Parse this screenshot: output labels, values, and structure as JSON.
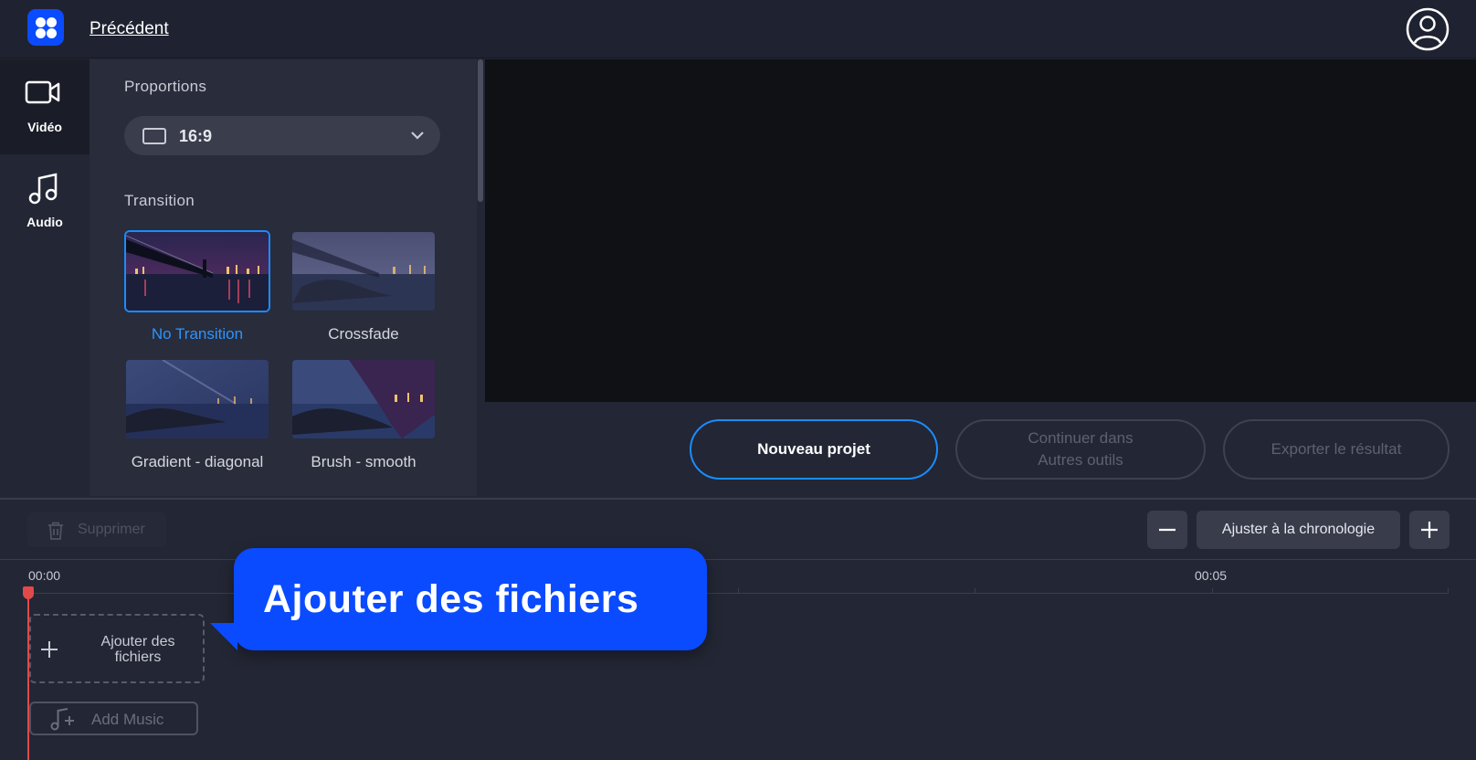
{
  "header": {
    "back_label": "Précédent"
  },
  "nav": {
    "items": [
      {
        "label": "Vidéo",
        "icon": "video-camera-icon"
      },
      {
        "label": "Audio",
        "icon": "music-note-icon"
      }
    ]
  },
  "panel": {
    "proportions_title": "Proportions",
    "aspect_ratio_value": "16:9",
    "transition_title": "Transition",
    "transitions": [
      {
        "label": "No Transition",
        "selected": true
      },
      {
        "label": "Crossfade",
        "selected": false
      },
      {
        "label": "Gradient - diagonal",
        "selected": false
      },
      {
        "label": "Brush - smooth",
        "selected": false
      }
    ]
  },
  "actions": {
    "new_project": "Nouveau projet",
    "continue_other_tools": "Continuer dans Autres outils",
    "export_result": "Exporter le résultat"
  },
  "toolbar": {
    "delete_label": "Supprimer",
    "fit_timeline_label": "Ajuster à la chronologie"
  },
  "timeline": {
    "time_start": "00:00",
    "time_mark": "00:05",
    "add_files_label": "Ajouter des fichiers",
    "add_music_label": "Add Music"
  },
  "callout": {
    "label": "Ajouter des fichiers"
  },
  "colors": {
    "accent": "#1a8cff",
    "brand_blue": "#0a4bff",
    "playhead": "#e04a4a"
  }
}
